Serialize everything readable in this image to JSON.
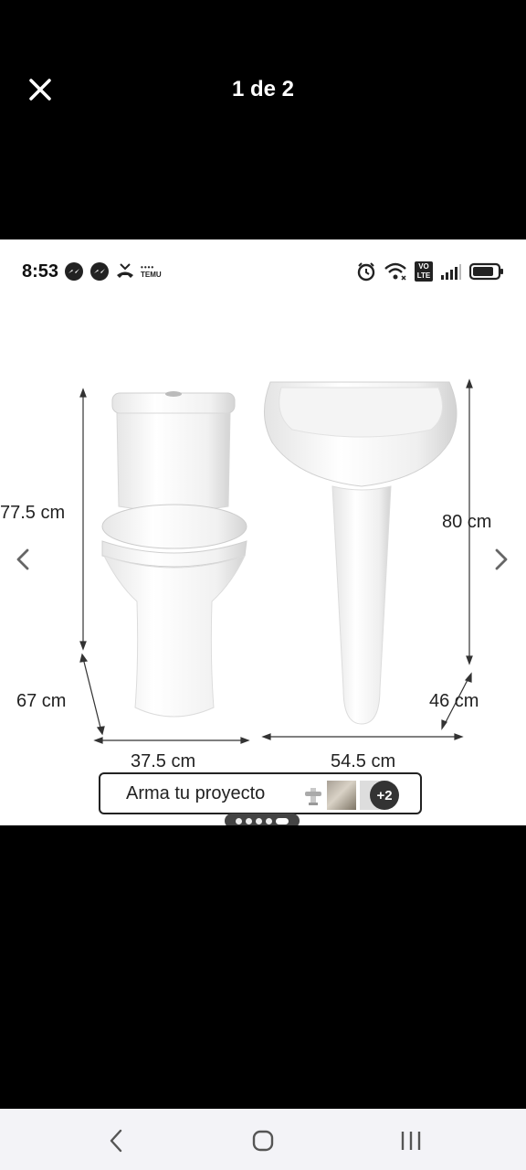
{
  "viewer": {
    "close_icon": "close-icon",
    "counter": "1 de 2"
  },
  "status_bar": {
    "time": "8:53",
    "notifications": [
      "messenger-icon",
      "messenger-icon",
      "missed-call-icon",
      "temu-icon"
    ],
    "temu_label": "TEMU",
    "right_icons": [
      "alarm-icon",
      "wifi-icon",
      "volte-icon",
      "signal-icon",
      "battery-icon"
    ],
    "volte_top": "VO",
    "volte_bottom": "LTE"
  },
  "product_image": {
    "toilet_height": "77.5 cm",
    "toilet_depth": "67 cm",
    "toilet_width": "37.5 cm",
    "sink_height": "80 cm",
    "sink_depth": "46 cm",
    "sink_width": "54.5 cm",
    "prev_icon": "chevron-left-icon",
    "next_icon": "chevron-right-icon"
  },
  "project_banner": {
    "label": "Arma tu proyecto",
    "more_count": "+2"
  },
  "carousel": {
    "total": 5,
    "active_index": 4
  },
  "system_nav": {
    "back_icon": "back-icon",
    "home_icon": "home-icon",
    "recents_icon": "recents-icon"
  },
  "colors": {
    "background": "#000000",
    "photo_background": "#ffffff",
    "nav_bar": "#f3f3f7"
  }
}
